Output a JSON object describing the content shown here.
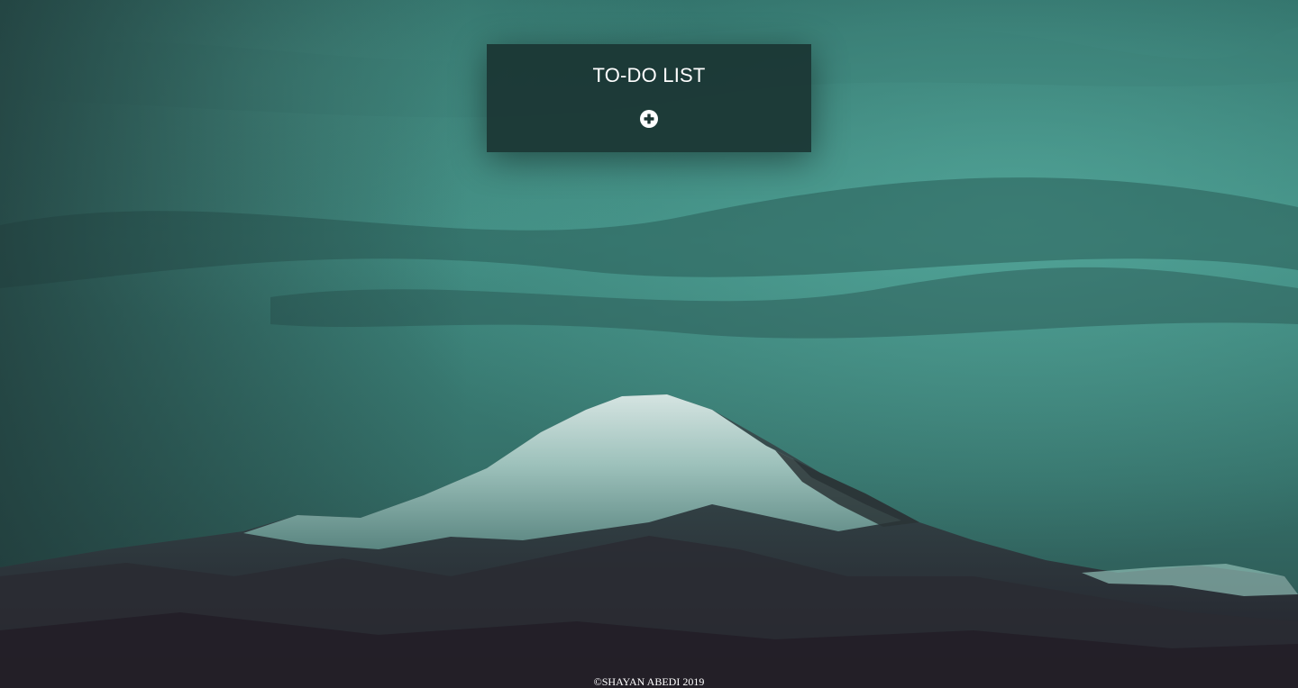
{
  "todo": {
    "title": "TO-DO LIST",
    "add_icon": "plus-circle-icon"
  },
  "footer": {
    "copyright": "©SHAYAN ABEDI 2019"
  },
  "colors": {
    "card_background": "#1a3432",
    "text": "#ffffff",
    "sky_accent": "#4fa89c"
  }
}
